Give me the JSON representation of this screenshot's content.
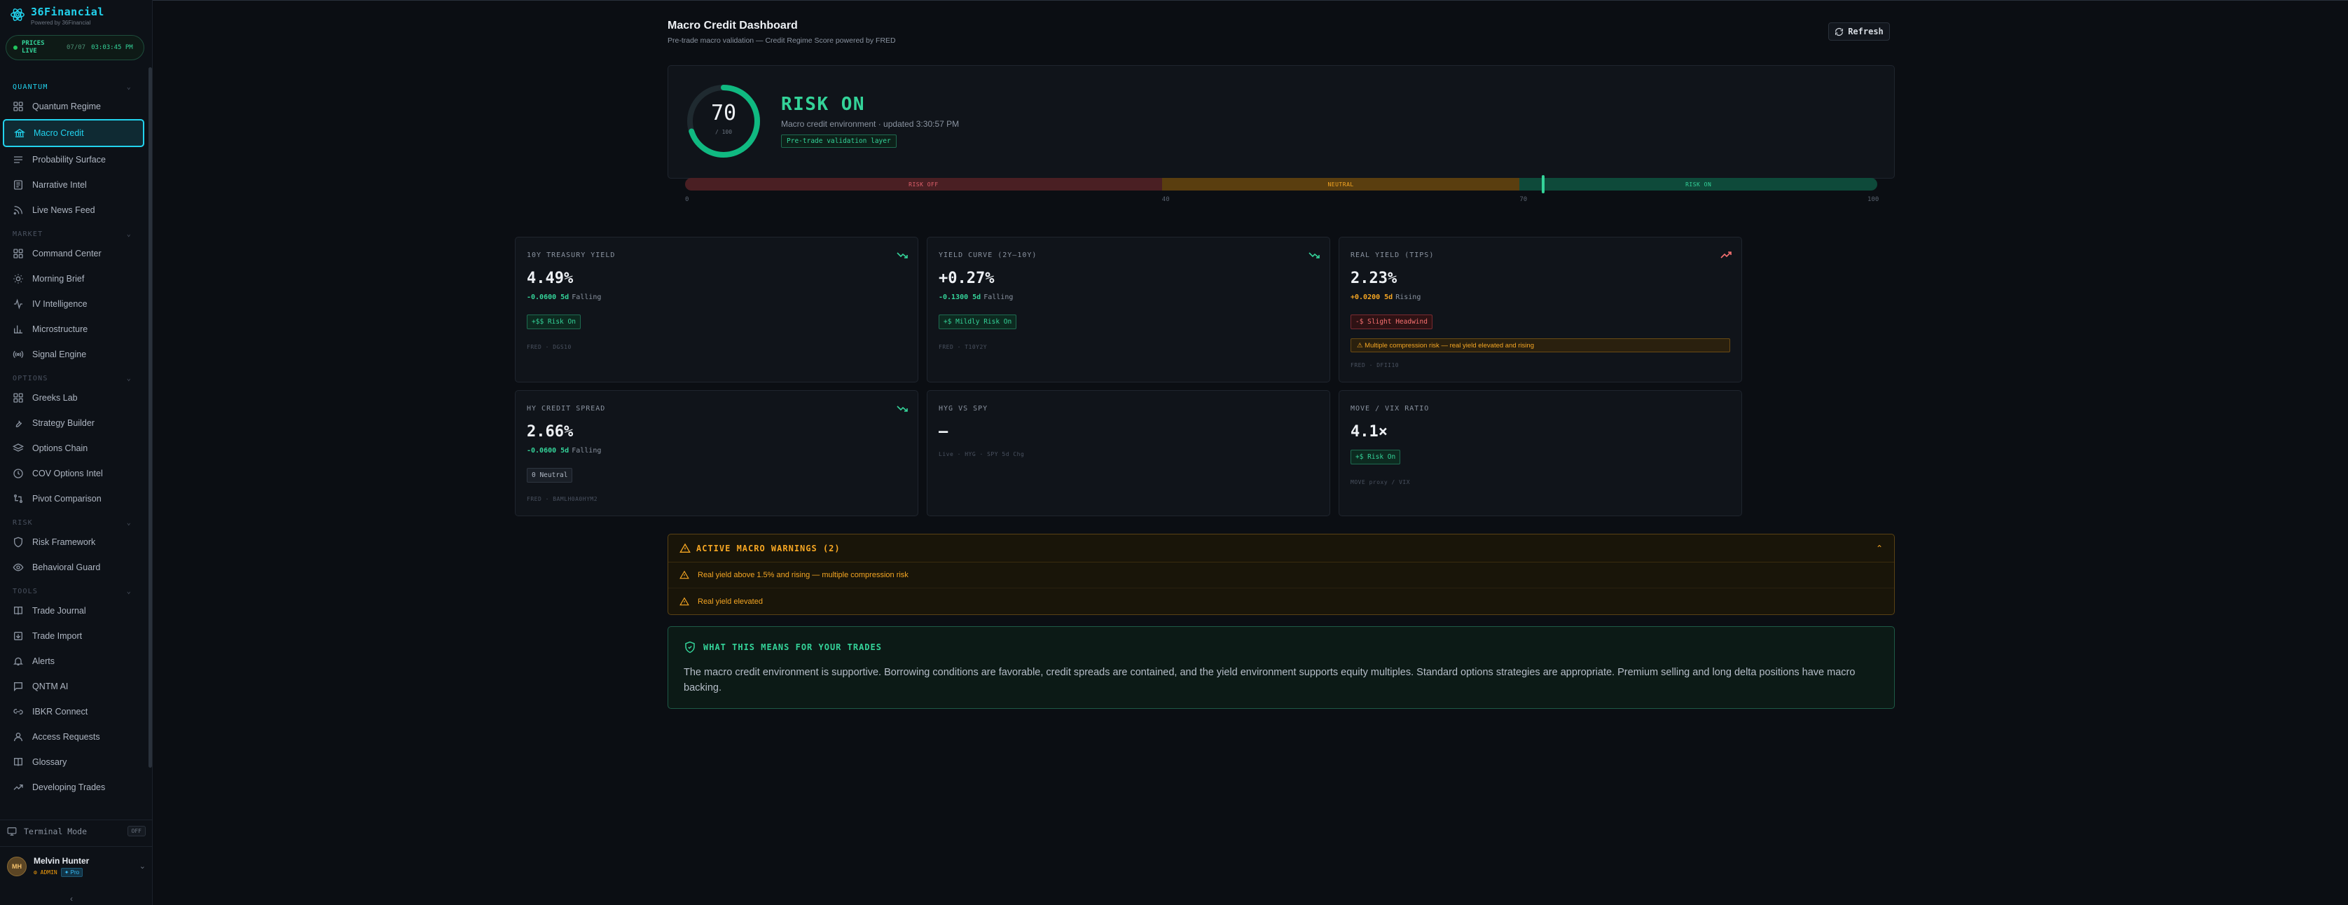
{
  "brand": {
    "title": "36Financial",
    "subtitle": "Powered by 36Financial"
  },
  "prices": {
    "label": "PRICES LIVE",
    "date": "07/07",
    "time": "03:03:45 PM"
  },
  "nav": {
    "sections": [
      {
        "title": "QUANTUM",
        "items": [
          "Quantum Regime",
          "Macro Credit",
          "Probability Surface",
          "Narrative Intel",
          "Live News Feed"
        ]
      },
      {
        "title": "MARKET",
        "items": [
          "Command Center",
          "Morning Brief",
          "IV Intelligence",
          "Microstructure",
          "Signal Engine"
        ]
      },
      {
        "title": "OPTIONS",
        "items": [
          "Greeks Lab",
          "Strategy Builder",
          "Options Chain",
          "COV Options Intel",
          "Pivot Comparison"
        ]
      },
      {
        "title": "RISK",
        "items": [
          "Risk Framework",
          "Behavioral Guard"
        ]
      },
      {
        "title": "TOOLS",
        "items": [
          "Trade Journal",
          "Trade Import",
          "Alerts",
          "QNTM AI",
          "IBKR Connect",
          "Access Requests",
          "Glossary",
          "Developing Trades"
        ]
      }
    ]
  },
  "terminal": {
    "label": "Terminal Mode",
    "state": "OFF"
  },
  "user": {
    "initials": "MH",
    "name": "Melvin Hunter",
    "role": "ADMIN",
    "plan": "Pro"
  },
  "header": {
    "title": "Macro Credit Dashboard",
    "subtitle": "Pre-trade macro validation — Credit Regime Score powered by FRED",
    "refresh_label": "Refresh"
  },
  "regime": {
    "score": 70,
    "max_label": "/ 100",
    "label": "RISK ON",
    "description": "Macro credit environment · updated 3:30:57 PM",
    "tag": "Pre-trade validation layer",
    "scale": {
      "segments": [
        "RISK OFF",
        "NEUTRAL",
        "RISK ON"
      ],
      "ticks": [
        "0",
        "40",
        "70",
        "100"
      ],
      "tick_values": [
        0,
        40,
        70,
        100
      ],
      "marker_value": 72,
      "colors": {
        "off": "#e0606c",
        "neutral": "#f5a623",
        "on": "#34d399"
      }
    }
  },
  "metrics": [
    {
      "title": "10Y TREASURY YIELD",
      "value": "4.49%",
      "change": "-0.0600 5d",
      "direction": "Falling",
      "badge": "+$$ Risk On",
      "badge_tone": "green",
      "source": "FRED · DGS10",
      "trend": "down",
      "warning": ""
    },
    {
      "title": "YIELD CURVE (2Y–10Y)",
      "value": "+0.27%",
      "change": "-0.1300 5d",
      "direction": "Falling",
      "badge": "+$ Mildly Risk On",
      "badge_tone": "green",
      "source": "FRED · T10Y2Y",
      "trend": "down",
      "warning": ""
    },
    {
      "title": "REAL YIELD (TIPS)",
      "value": "2.23%",
      "change": "+0.0200 5d",
      "direction": "Rising",
      "badge": "-$ Slight Headwind",
      "badge_tone": "red",
      "source": "FRED · DFII10",
      "trend": "up",
      "warning": "⚠ Multiple compression risk — real yield elevated and rising"
    },
    {
      "title": "HY CREDIT SPREAD",
      "value": "2.66%",
      "change": "-0.0600 5d",
      "direction": "Falling",
      "badge": "0 Neutral",
      "badge_tone": "gray",
      "source": "FRED · BAMLH0A0HYM2",
      "trend": "down",
      "warning": ""
    },
    {
      "title": "HYG VS SPY",
      "value": "—",
      "change": "",
      "direction": "",
      "badge": "",
      "badge_tone": "",
      "source": "Live · HYG · SPY 5d Chg",
      "trend": "",
      "warning": ""
    },
    {
      "title": "MOVE / VIX RATIO",
      "value": "4.1×",
      "change": "",
      "direction": "",
      "badge": "+$ Risk On",
      "badge_tone": "green",
      "source": "MOVE proxy / VIX",
      "trend": "",
      "warning": ""
    }
  ],
  "warnings": {
    "title": "ACTIVE MACRO WARNINGS (2)",
    "items": [
      "Real yield above 1.5% and rising — multiple compression risk",
      "Real yield elevated"
    ]
  },
  "meaning": {
    "title": "WHAT THIS MEANS FOR YOUR TRADES",
    "body": "The macro credit environment is supportive. Borrowing conditions are favorable, credit spreads are contained, and the yield environment supports equity multiples. Standard options strategies are appropriate. Premium selling and long delta positions have macro backing."
  },
  "colors": {
    "accent": "#22d3ee",
    "green": "#34d399",
    "red": "#f87171",
    "amber": "#f5a623"
  }
}
